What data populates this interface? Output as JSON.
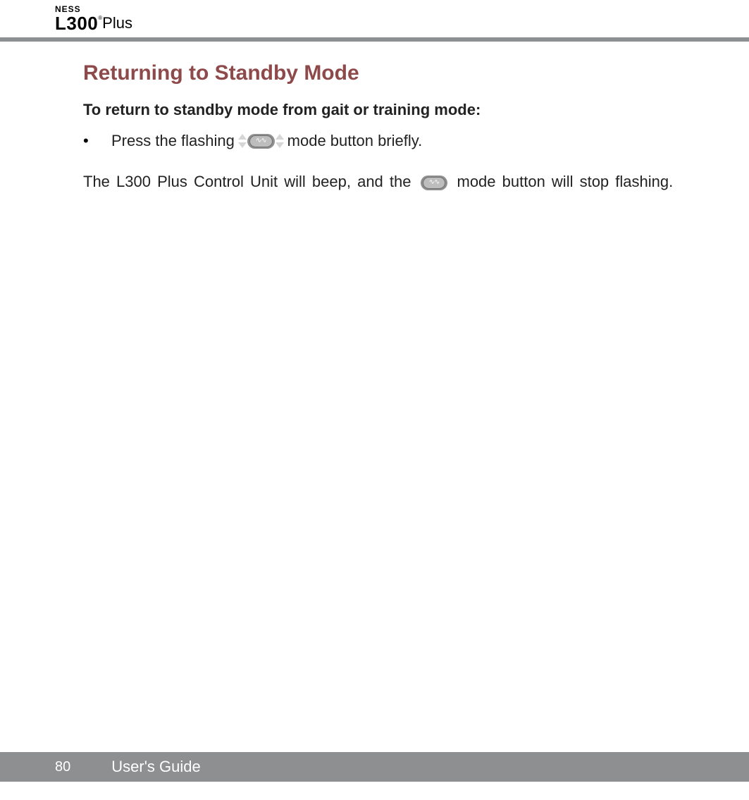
{
  "logo": {
    "brand": "NESS",
    "model": "L300",
    "reg": "®",
    "suffix": "Plus"
  },
  "heading": "Returning to Standby Mode",
  "subheading": "To return to standby mode from gait or training mode:",
  "bullet": {
    "marker": "•",
    "text_before": "Press the flashing",
    "text_after": "mode button briefly."
  },
  "body": {
    "part1": "The L300 Plus Control Unit will beep, and the",
    "part2": "mode button will stop flashing."
  },
  "footer": {
    "page": "80",
    "title": "User's Guide"
  }
}
